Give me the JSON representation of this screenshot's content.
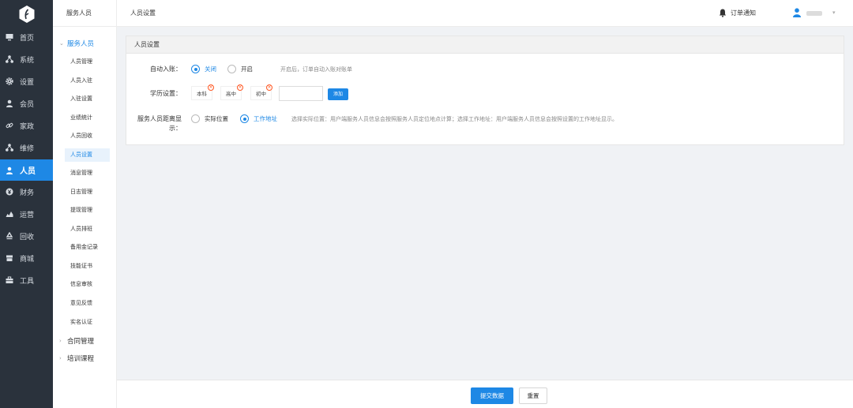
{
  "nav": {
    "items": [
      {
        "label": "首页",
        "icon": "monitor-icon"
      },
      {
        "label": "系统",
        "icon": "hierarchy-icon"
      },
      {
        "label": "设置",
        "icon": "gear-icon"
      },
      {
        "label": "会员",
        "icon": "user-icon"
      },
      {
        "label": "家政",
        "icon": "link-icon"
      },
      {
        "label": "维修",
        "icon": "hierarchy-icon"
      },
      {
        "label": "人员",
        "icon": "user-icon",
        "active": true
      },
      {
        "label": "财务",
        "icon": "yen-icon"
      },
      {
        "label": "运营",
        "icon": "chart-icon"
      },
      {
        "label": "回收",
        "icon": "recycle-icon"
      },
      {
        "label": "商城",
        "icon": "shop-icon"
      },
      {
        "label": "工具",
        "icon": "toolbox-icon"
      }
    ]
  },
  "submenu": {
    "header": "服务人员",
    "group_open": "服务人员",
    "items": [
      "人员管理",
      "人员入驻",
      "入驻设置",
      "业绩统计",
      "人员回收",
      "人员设置",
      "消息管理",
      "日志管理",
      "提现管理",
      "人员排班",
      "备用金记录",
      "技能证书",
      "信息审核",
      "意见反馈",
      "实名认证"
    ],
    "active_index": 5,
    "closed_groups": [
      "合同管理",
      "培训课程"
    ]
  },
  "topbar": {
    "breadcrumb": "人员设置",
    "notice": "订单通知"
  },
  "panel": {
    "title": "人员设置",
    "auto_account": {
      "label": "自动入账：",
      "options": [
        "关闭",
        "开启"
      ],
      "selected": "关闭",
      "hint": "开启后，订单自动入账对账单"
    },
    "education": {
      "label": "学历设置：",
      "tags": [
        "本科",
        "高中",
        "初中"
      ],
      "input_value": "",
      "add_label": "添加"
    },
    "distance": {
      "label_line1": "服务人员距离显",
      "label_line2": "示：",
      "options": [
        "实际位置",
        "工作地址"
      ],
      "selected": "工作地址",
      "hint": "选择实际位置：用户端服务人员信息会按照服务人员定位地点计算；选择工作地址：用户端服务人员信息会按照设置的工作地址显示。"
    }
  },
  "footer": {
    "submit_label": "提交数据",
    "reset_label": "重置"
  },
  "colors": {
    "accent": "#1e88e5",
    "sidebar": "#2a323c",
    "remove": "#ff5722"
  }
}
